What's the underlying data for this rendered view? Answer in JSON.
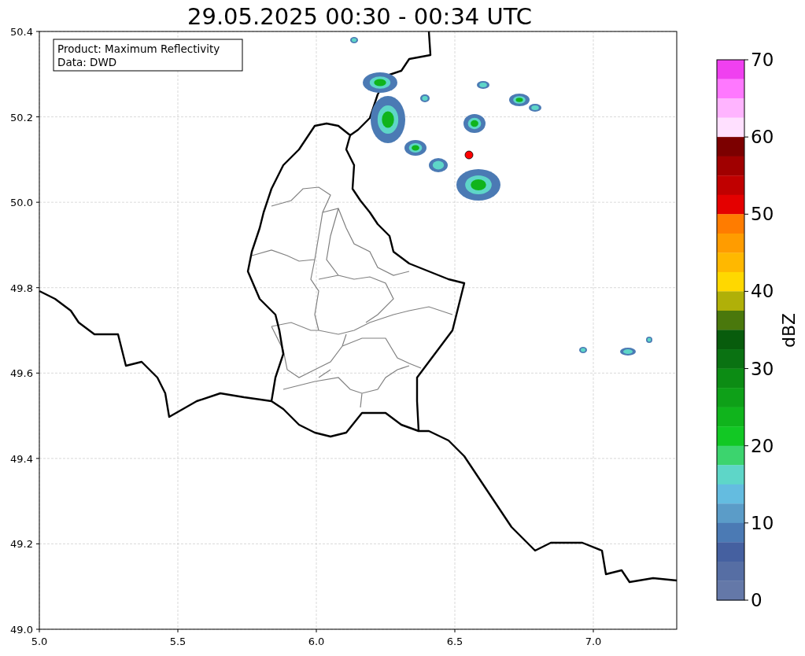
{
  "title": "29.05.2025 00:30 - 00:34 UTC",
  "info_box": [
    "Product: Maximum Reflectivity",
    "Data: DWD"
  ],
  "x_ticks": [
    "5.0",
    "5.5",
    "6.0",
    "6.5",
    "7.0"
  ],
  "y_ticks": [
    "50.4",
    "50.2",
    "50.0",
    "49.8",
    "49.6",
    "49.4",
    "49.2",
    "49.0"
  ],
  "colorbar": {
    "label": "dBZ",
    "ticks": [
      "70",
      "60",
      "50",
      "40",
      "30",
      "20",
      "10",
      "0"
    ],
    "segments": [
      {
        "color": "#f040f0"
      },
      {
        "color": "#ff78ff"
      },
      {
        "color": "#ffb4ff"
      },
      {
        "color": "#ffe0ff"
      },
      {
        "color": "#7c0000"
      },
      {
        "color": "#a00000"
      },
      {
        "color": "#c00000"
      },
      {
        "color": "#e40000"
      },
      {
        "color": "#ff7c00"
      },
      {
        "color": "#ff9c00"
      },
      {
        "color": "#ffb800"
      },
      {
        "color": "#ffd800"
      },
      {
        "color": "#b0b008"
      },
      {
        "color": "#4a780c"
      },
      {
        "color": "#085c0c"
      },
      {
        "color": "#0a7212"
      },
      {
        "color": "#0c8c14"
      },
      {
        "color": "#0ea018"
      },
      {
        "color": "#10b41c"
      },
      {
        "color": "#12c824"
      },
      {
        "color": "#3cd46e"
      },
      {
        "color": "#5ed6c8"
      },
      {
        "color": "#64bce0"
      },
      {
        "color": "#5b9cc8"
      },
      {
        "color": "#4b7ab4"
      },
      {
        "color": "#4560a0"
      },
      {
        "color": "#566ea4"
      },
      {
        "color": "#6478a8"
      }
    ]
  }
}
